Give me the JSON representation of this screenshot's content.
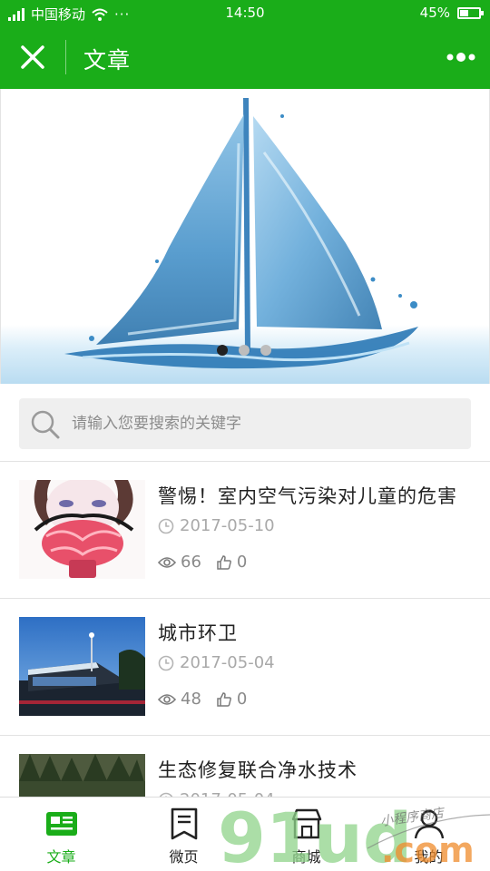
{
  "status_bar": {
    "carrier": "中国移动",
    "time": "14:50",
    "battery": "45%",
    "battery_level": 0.45,
    "icons": [
      "signal-icon",
      "wifi-icon",
      "more-dots-icon",
      "battery-icon"
    ]
  },
  "header": {
    "title": "文章",
    "close_icon": "close-icon",
    "more_icon": "more-options-icon"
  },
  "banner": {
    "image": "water-sailboat-image",
    "slide_count": 3,
    "active_slide": 1
  },
  "search": {
    "placeholder": "请输入您要搜索的关键字",
    "value": ""
  },
  "articles": [
    {
      "title": "警惕！室内空气污染对儿童的危害",
      "date": "2017-05-10",
      "views": "66",
      "likes": "0",
      "thumb": "gas-mask-illustration"
    },
    {
      "title": "城市环卫",
      "date": "2017-05-04",
      "views": "48",
      "likes": "0",
      "thumb": "city-building-photo"
    },
    {
      "title": "生态修复联合净水技术",
      "date": "2017-05-04",
      "thumb": "forest-photo"
    }
  ],
  "bottom_nav": [
    {
      "label": "文章",
      "icon": "article-icon",
      "active": true
    },
    {
      "label": "微页",
      "icon": "micro-page-icon",
      "active": false
    },
    {
      "label": "商城",
      "icon": "store-icon",
      "active": false
    },
    {
      "label": "我的",
      "icon": "profile-icon",
      "active": false
    }
  ],
  "colors": {
    "brand_green": "#1aad19",
    "text_dark": "#222222",
    "text_gray": "#a9a9a9",
    "watermark_green": "#8fd48a",
    "watermark_orange": "#f08c2b"
  },
  "watermark": {
    "big": "91ud",
    "domain": ".com",
    "script": "小程序商店"
  }
}
